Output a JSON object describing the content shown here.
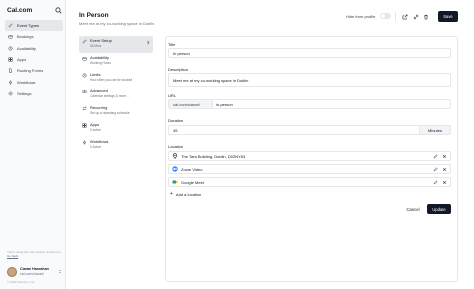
{
  "app": {
    "brand": "Cal.com"
  },
  "sidebar": {
    "items": [
      {
        "label": "Event Types",
        "icon": "link-icon"
      },
      {
        "label": "Bookings",
        "icon": "calendar-icon"
      },
      {
        "label": "Availability",
        "icon": "clock-icon"
      },
      {
        "label": "Apps",
        "icon": "grid-icon"
      },
      {
        "label": "Routing Forms",
        "icon": "file-icon"
      },
      {
        "label": "Workflows",
        "icon": "zap-icon"
      },
      {
        "label": "Settings",
        "icon": "gear-icon"
      }
    ],
    "note_text": "You're using the new version of Cal.com.",
    "note_link": "Go back",
    "user": {
      "name": "Ciarán Hanrahan",
      "link": "cal.com/ciaran/"
    },
    "footer": "© 2022 Cal.com, Inc."
  },
  "header": {
    "title": "In Person",
    "subtitle": "Meet me at my co-working space in Dublin",
    "hide_label": "Hide from profile",
    "save_label": "Save"
  },
  "tabs": [
    {
      "title": "Event Setup",
      "sub": "45 Mins",
      "icon": "link-icon",
      "active": true
    },
    {
      "title": "Availability",
      "sub": "Working Hours",
      "icon": "calendar-icon",
      "active": false
    },
    {
      "title": "Limits",
      "sub": "How often you can be booked",
      "icon": "clock-icon",
      "active": false
    },
    {
      "title": "Advanced",
      "sub": "Calendar settings & more...",
      "icon": "sliders-icon",
      "active": false
    },
    {
      "title": "Recurring",
      "sub": "Set up a repeating schedule",
      "icon": "repeat-icon",
      "active": false
    },
    {
      "title": "Apps",
      "sub": "0 active",
      "icon": "grid-icon",
      "active": false
    },
    {
      "title": "Workflows",
      "sub": "0 Active",
      "icon": "zap-icon",
      "active": false
    }
  ],
  "form": {
    "title_label": "Title",
    "title_value": "In person",
    "description_label": "Description",
    "description_value": "Meet me at my co-working space in Dublin",
    "url_label": "URL",
    "url_prefix": "cal.com/ciaran/",
    "url_value": "in-person",
    "duration_label": "Duration",
    "duration_value": "45",
    "duration_unit": "Minutes",
    "location_label": "Location",
    "locations": [
      {
        "label": "The Tara Building, Dublin, D02NY63",
        "icon": "map-pin-icon"
      },
      {
        "label": "Zoom Video",
        "icon": "zoom-icon"
      },
      {
        "label": "Google Meet",
        "icon": "google-meet-icon"
      }
    ],
    "add_location": "Add a location",
    "cancel_label": "Cancel",
    "update_label": "Update"
  }
}
